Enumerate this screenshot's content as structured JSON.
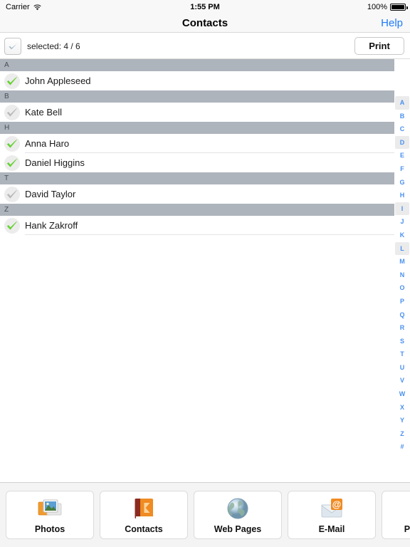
{
  "statusbar": {
    "carrier": "Carrier",
    "wifi_icon": "wifi-icon",
    "time": "1:55 PM",
    "battery_percent": "100%",
    "battery_icon": "battery-full-icon"
  },
  "navbar": {
    "title": "Contacts",
    "help_label": "Help"
  },
  "toolbar": {
    "checkbox_icon": "checkbox-mixed-icon",
    "selected_label": "selected: 4 / 6",
    "print_label": "Print"
  },
  "colors": {
    "accent_blue": "#1f7bf6",
    "index_blue": "#4a90f0",
    "section_header_bg": "#aeb4bc",
    "check_green": "#63d12e",
    "check_gray": "#b8b8b8"
  },
  "list": {
    "sections": [
      {
        "letter": "A",
        "rows": [
          {
            "name": "John Appleseed",
            "checked": true,
            "check_icon": "check-green-icon"
          }
        ]
      },
      {
        "letter": "B",
        "rows": [
          {
            "name": "Kate Bell",
            "checked": false,
            "check_icon": "check-gray-icon"
          }
        ]
      },
      {
        "letter": "H",
        "rows": [
          {
            "name": "Anna Haro",
            "checked": true,
            "check_icon": "check-green-icon"
          },
          {
            "name": "Daniel Higgins",
            "checked": true,
            "check_icon": "check-green-icon"
          }
        ]
      },
      {
        "letter": "T",
        "rows": [
          {
            "name": "David Taylor",
            "checked": false,
            "check_icon": "check-gray-icon"
          }
        ]
      },
      {
        "letter": "Z",
        "rows": [
          {
            "name": "Hank Zakroff",
            "checked": true,
            "check_icon": "check-green-icon"
          }
        ]
      }
    ]
  },
  "index_bar": {
    "letters": [
      "A",
      "B",
      "C",
      "D",
      "E",
      "F",
      "G",
      "H",
      "I",
      "J",
      "K",
      "L",
      "M",
      "N",
      "O",
      "P",
      "Q",
      "R",
      "S",
      "T",
      "U",
      "V",
      "W",
      "X",
      "Y",
      "Z",
      "#"
    ],
    "highlighted": [
      "A",
      "D",
      "I",
      "L"
    ]
  },
  "tabbar": {
    "tabs": [
      {
        "label": "Photos",
        "icon": "photos-icon"
      },
      {
        "label": "Contacts",
        "icon": "address-book-icon"
      },
      {
        "label": "Web Pages",
        "icon": "globe-icon"
      },
      {
        "label": "E-Mail",
        "icon": "envelope-at-icon"
      },
      {
        "label": "Paste to P",
        "icon": "clipboard-icon"
      }
    ]
  }
}
